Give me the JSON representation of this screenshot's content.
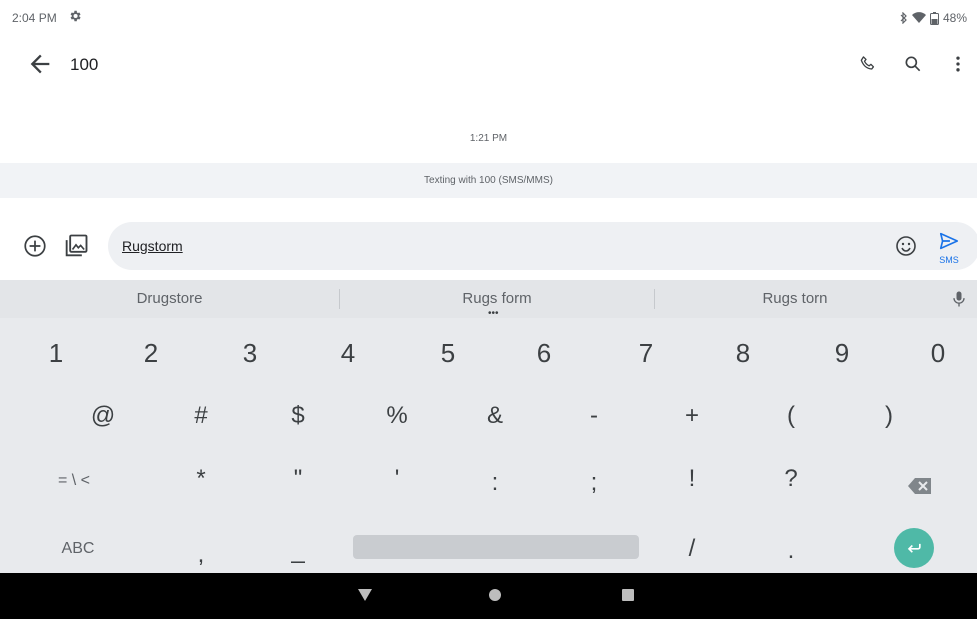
{
  "status_bar": {
    "time": "2:04 PM",
    "battery": "48%"
  },
  "app_bar": {
    "title": "100"
  },
  "conversation": {
    "timestamp": "1:21 PM",
    "texting_info": "Texting with 100 (SMS/MMS)"
  },
  "compose": {
    "input_value": "Rugstorm",
    "send_label": "SMS"
  },
  "keyboard": {
    "suggestions": [
      "Drugstore",
      "Rugs form",
      "Rugs torn"
    ],
    "row1": [
      "1",
      "2",
      "3",
      "4",
      "5",
      "6",
      "7",
      "8",
      "9",
      "0"
    ],
    "row2": [
      "@",
      "#",
      "$",
      "%",
      "&",
      "-",
      "+",
      "(",
      ")"
    ],
    "row3": [
      "= \\ <",
      "*",
      "\"",
      "'",
      ":",
      ";",
      "!",
      "?"
    ],
    "row4": {
      "abc": "ABC",
      "comma": ",",
      "underscore": "_",
      "slash": "/",
      "period": "."
    }
  },
  "colors": {
    "accent": "#1a73e8",
    "enter_key": "#4fb9a7",
    "keyboard_bg": "#e8eaed",
    "nav_bg": "#000000"
  }
}
